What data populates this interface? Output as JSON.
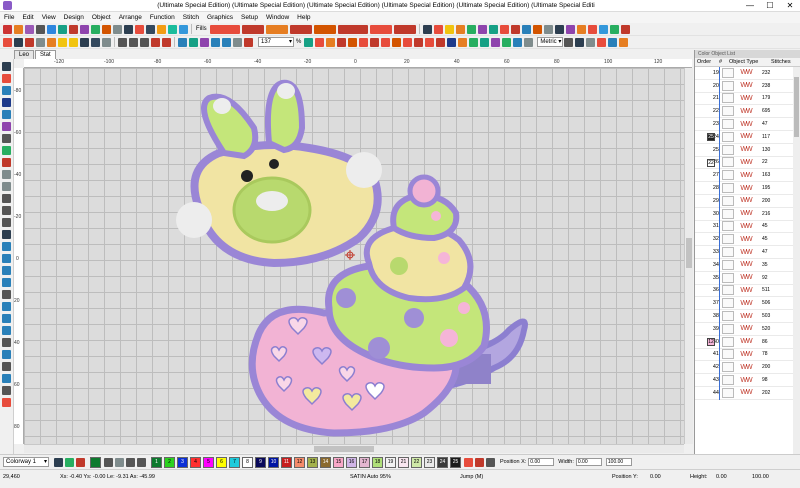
{
  "window": {
    "title": "(Ultimate Special Edition) (Ultimate Special Edition) (Ultimate Special Edition) (Ultimate Special Edition) (Ultimate Special Edition) (Ultimate Special Editi",
    "min": "—",
    "max": "☐",
    "close": "✕"
  },
  "menu": [
    "File",
    "Edit",
    "View",
    "Design",
    "Object",
    "Arrange",
    "Function",
    "Stitch",
    "Graphics",
    "Setup",
    "Window",
    "Help"
  ],
  "toolbar1": {
    "fills_label": "Fills"
  },
  "toolbar2": {
    "zoom_value": "137",
    "zoom_unit": "%",
    "metric_value": "Metric"
  },
  "tabs": [
    "Leo",
    "Stat"
  ],
  "ruler_top_ticks": [
    "-120",
    "-100",
    "-80",
    "-60",
    "-40",
    "-20",
    "0",
    "20",
    "40",
    "60",
    "80",
    "100",
    "120"
  ],
  "ruler_left_ticks": [
    "-80",
    "-60",
    "-40",
    "-20",
    "0",
    "20",
    "40",
    "60",
    "80"
  ],
  "panel": {
    "title": "Color Object List",
    "headers": [
      "Order",
      "#",
      "Object Type",
      "Stitches"
    ],
    "rows": [
      {
        "n": "19",
        "st": "232"
      },
      {
        "n": "20",
        "st": "238"
      },
      {
        "n": "21",
        "st": "179"
      },
      {
        "n": "22",
        "st": "695"
      },
      {
        "n": "23",
        "st": "47"
      },
      {
        "n": "24",
        "st": "117"
      },
      {
        "n": "25",
        "st": "130"
      },
      {
        "n": "26",
        "st": "22"
      },
      {
        "n": "27",
        "st": "163"
      },
      {
        "n": "28",
        "st": "195"
      },
      {
        "n": "29",
        "st": "200"
      },
      {
        "n": "30",
        "st": "216"
      },
      {
        "n": "31",
        "st": "45"
      },
      {
        "n": "32",
        "st": "45"
      },
      {
        "n": "33",
        "st": "47"
      },
      {
        "n": "34",
        "st": "35"
      },
      {
        "n": "35",
        "st": "92"
      },
      {
        "n": "36",
        "st": "511"
      },
      {
        "n": "37",
        "st": "506"
      },
      {
        "n": "38",
        "st": "503"
      },
      {
        "n": "39",
        "st": "520"
      },
      {
        "n": "40",
        "st": "86"
      },
      {
        "n": "41",
        "st": "78"
      },
      {
        "n": "42",
        "st": "200"
      },
      {
        "n": "43",
        "st": "98"
      },
      {
        "n": "44",
        "st": "202"
      }
    ],
    "markers": {
      "24": "25",
      "26": "22",
      "40": "12"
    }
  },
  "palette": {
    "colorway": "Colorway 1",
    "swatches": [
      {
        "label": "1",
        "color": "#0d7a2e"
      },
      {
        "label": "2",
        "color": "#2bd11f"
      },
      {
        "label": "3",
        "color": "#0b2fd6"
      },
      {
        "label": "4",
        "color": "#ff3030"
      },
      {
        "label": "5",
        "color": "#ff00ff"
      },
      {
        "label": "6",
        "color": "#ffff00"
      },
      {
        "label": "7",
        "color": "#1ecbdc"
      },
      {
        "label": "8",
        "color": "#ffffff"
      },
      {
        "label": "9",
        "color": "#0a0a5a"
      },
      {
        "label": "10",
        "color": "#0015a3"
      },
      {
        "label": "11",
        "color": "#c61e1e"
      },
      {
        "label": "12",
        "color": "#f58b6b"
      },
      {
        "label": "13",
        "color": "#a3b14c"
      },
      {
        "label": "14",
        "color": "#8a6a2f"
      },
      {
        "label": "15",
        "color": "#f9a8c8"
      },
      {
        "label": "16",
        "color": "#cfb4e6"
      },
      {
        "label": "17",
        "color": "#e3b6d0"
      },
      {
        "label": "18",
        "color": "#b0e07a"
      },
      {
        "label": "19",
        "color": "#f2f2f2"
      },
      {
        "label": "21",
        "color": "#f9e6f0"
      },
      {
        "label": "22",
        "color": "#cfe9a8"
      },
      {
        "label": "23",
        "color": "#eaeaea"
      },
      {
        "label": "24",
        "color": "#3a3a3a"
      },
      {
        "label": "25",
        "color": "#1a1a1a"
      }
    ],
    "position_x_label": "Position X:",
    "position_x": "0.00",
    "position_y_label": "Position Y:",
    "position_y": "0.00",
    "width_label": "Width:",
    "width": "0.00",
    "height_label": "Height:",
    "height": "0.00",
    "pct1": "100.00",
    "pct2": "100.00"
  },
  "status": {
    "zoom": "29,460",
    "coords": "Xs: -0.40 Ys: -0.00 Le: -9.31 As: -45.99",
    "mode": "SATIN Auto 95%",
    "jump": "Jump (M)"
  }
}
